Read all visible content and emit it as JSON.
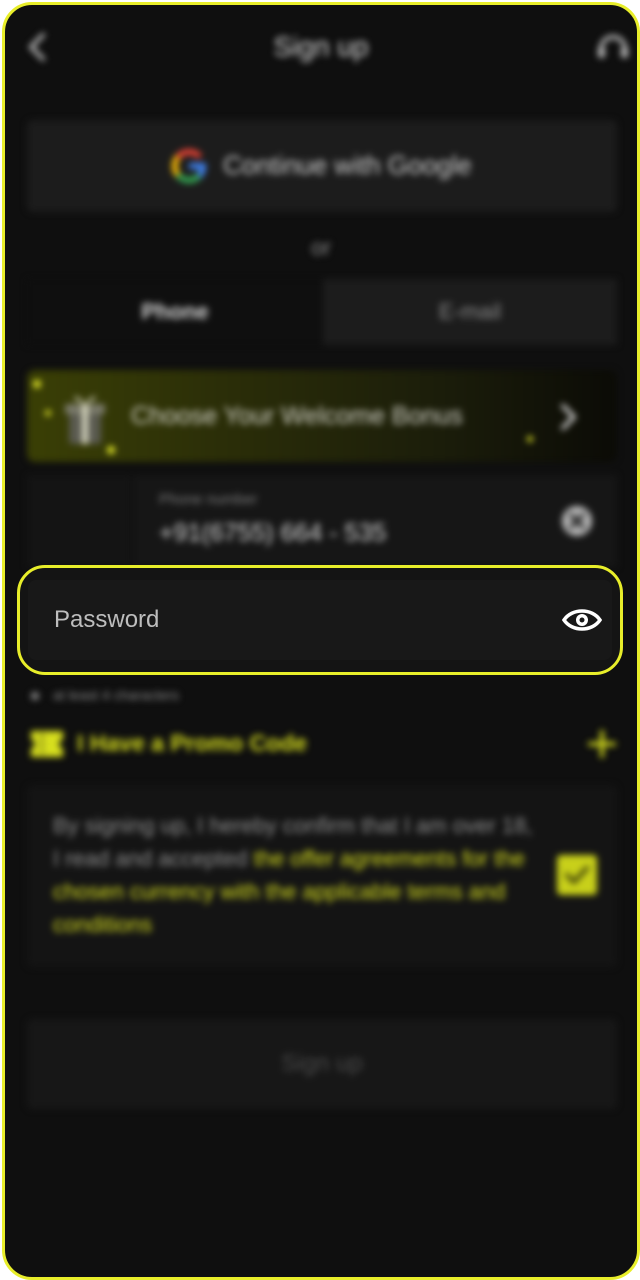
{
  "header": {
    "title": "Sign up",
    "back_icon": "back-arrow-icon",
    "support_icon": "support-headset-icon"
  },
  "google": {
    "label": "Continue with Google",
    "icon": "google-icon"
  },
  "divider": {
    "or_text": "or"
  },
  "tabs": [
    {
      "label": "Phone",
      "selected": true
    },
    {
      "label": "E-mail",
      "selected": false
    }
  ],
  "bonus": {
    "label": "Choose Your Welcome Bonus",
    "icon": "gift-icon"
  },
  "phone": {
    "label": "Phone number",
    "value": "+91(6755) 664 - 535"
  },
  "password": {
    "placeholder": "Password",
    "value": "",
    "icon": "eye-icon"
  },
  "hint": {
    "text": "at least 4 characters"
  },
  "promo": {
    "label": "I Have a Promo Code",
    "icon": "ticket-icon"
  },
  "terms": {
    "text": "By signing up, I hereby confirm that I am over 18, I read and accepted ",
    "link": "the offer agreements for the chosen currency with the applicable terms and conditions",
    "checked": true
  },
  "submit": {
    "label": "Sign up"
  },
  "colors": {
    "accent": "#e8ee2a",
    "background": "#0f0f0f",
    "surface": "#1c1c1c"
  }
}
